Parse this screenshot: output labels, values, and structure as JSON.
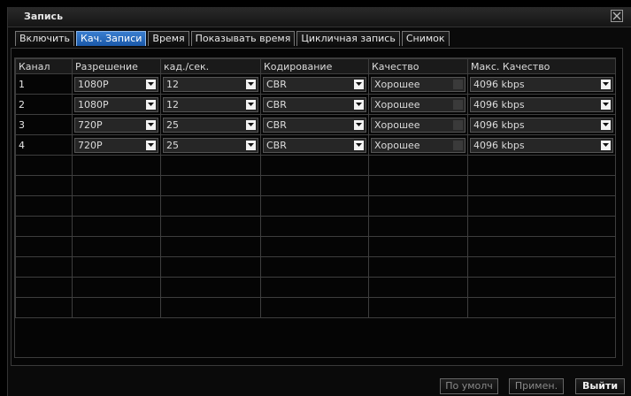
{
  "window": {
    "title": "Запись"
  },
  "tabs": [
    {
      "label": "Включить",
      "active": false
    },
    {
      "label": "Кач. Записи",
      "active": true
    },
    {
      "label": "Время",
      "active": false
    },
    {
      "label": "Показывать время",
      "active": false
    },
    {
      "label": "Цикличная запись",
      "active": false
    },
    {
      "label": "Снимок",
      "active": false
    }
  ],
  "table": {
    "headers": [
      "Канал",
      "Разрешение",
      "кад./сек.",
      "Кодирование",
      "Качество",
      "Макс. Качество"
    ],
    "rows": [
      {
        "channel": "1",
        "resolution": "1080P",
        "fps": "12",
        "encoding": "CBR",
        "quality": "Хорошее",
        "max_quality": "4096 kbps"
      },
      {
        "channel": "2",
        "resolution": "1080P",
        "fps": "12",
        "encoding": "CBR",
        "quality": "Хорошее",
        "max_quality": "4096 kbps"
      },
      {
        "channel": "3",
        "resolution": "720P",
        "fps": "25",
        "encoding": "CBR",
        "quality": "Хорошее",
        "max_quality": "4096 kbps"
      },
      {
        "channel": "4",
        "resolution": "720P",
        "fps": "25",
        "encoding": "CBR",
        "quality": "Хорошее",
        "max_quality": "4096 kbps"
      }
    ],
    "empty_rows": 8
  },
  "buttons": {
    "default": "По умолч",
    "apply": "Примен.",
    "exit": "Выйти"
  },
  "colors": {
    "active_tab": "#2a6cc0",
    "background": "#000000"
  }
}
